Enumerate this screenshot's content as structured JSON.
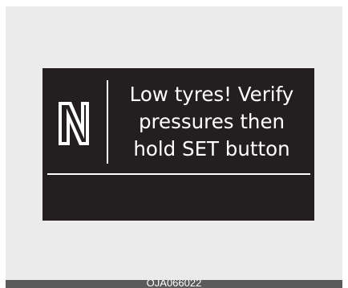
{
  "display": {
    "gear_indicator": "N",
    "message_lines": [
      "Low tyres! Verify",
      "pressures then",
      "hold SET button"
    ]
  },
  "caption": "OJA066022",
  "colors": {
    "display_background": "#231f20",
    "display_text": "#ffffff",
    "frame_background": "#ebebeb",
    "caption_bar": "#5a5a5a"
  }
}
